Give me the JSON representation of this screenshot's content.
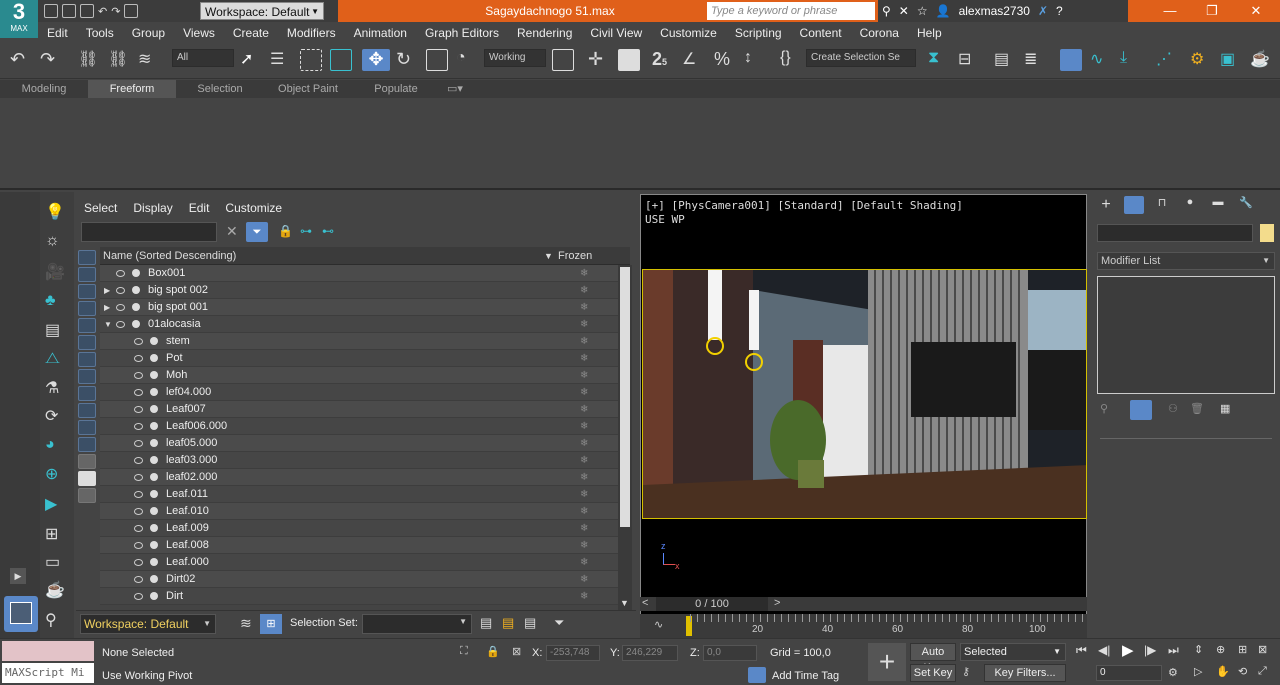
{
  "app": {
    "logo_number": "3",
    "logo_label": "MAX",
    "workspace": "Workspace: Default",
    "filename": "Sagaydachnogo 51.max",
    "search_placeholder": "Type a keyword or phrase",
    "user": "alexmas2730"
  },
  "menu": [
    "Edit",
    "Tools",
    "Group",
    "Views",
    "Create",
    "Modifiers",
    "Animation",
    "Graph Editors",
    "Rendering",
    "Civil View",
    "Customize",
    "Scripting",
    "Content",
    "Corona",
    "Help"
  ],
  "toolbar": {
    "filter_all": "All",
    "coord_system": "Working",
    "snap_label": "2",
    "snap_sub": "5",
    "percent_snap": "%",
    "selection_set": "Create Selection Se"
  },
  "ribbon_tabs": [
    "Modeling",
    "Freeform",
    "Selection",
    "Object Paint",
    "Populate"
  ],
  "explorer": {
    "menu": [
      "Select",
      "Display",
      "Edit",
      "Customize"
    ],
    "col_name": "Name (Sorted Descending)",
    "col_frozen": "Frozen",
    "frozen_glyph": "❄",
    "rows": [
      {
        "name": "Box001",
        "level": 0,
        "expand": ""
      },
      {
        "name": "big spot 002",
        "level": 0,
        "expand": "▶"
      },
      {
        "name": "big spot 001",
        "level": 0,
        "expand": "▶"
      },
      {
        "name": "01alocasia",
        "level": 0,
        "expand": "▼"
      },
      {
        "name": "stem",
        "level": 1,
        "expand": ""
      },
      {
        "name": "Pot",
        "level": 1,
        "expand": ""
      },
      {
        "name": "Moh",
        "level": 1,
        "expand": ""
      },
      {
        "name": "lef04.000",
        "level": 1,
        "expand": ""
      },
      {
        "name": "Leaf007",
        "level": 1,
        "expand": ""
      },
      {
        "name": "Leaf006.000",
        "level": 1,
        "expand": ""
      },
      {
        "name": "leaf05.000",
        "level": 1,
        "expand": ""
      },
      {
        "name": "leaf03.000",
        "level": 1,
        "expand": ""
      },
      {
        "name": "leaf02.000",
        "level": 1,
        "expand": ""
      },
      {
        "name": "Leaf.011",
        "level": 1,
        "expand": ""
      },
      {
        "name": "Leaf.010",
        "level": 1,
        "expand": ""
      },
      {
        "name": "Leaf.009",
        "level": 1,
        "expand": ""
      },
      {
        "name": "Leaf.008",
        "level": 1,
        "expand": ""
      },
      {
        "name": "Leaf.000",
        "level": 1,
        "expand": ""
      },
      {
        "name": "Dirt02",
        "level": 1,
        "expand": ""
      },
      {
        "name": "Dirt",
        "level": 1,
        "expand": ""
      }
    ],
    "workspace": "Workspace: Default",
    "selection_set_label": "Selection Set:"
  },
  "viewport": {
    "label": "[+] [PhysCamera001] [Standard] [Default Shading]",
    "label2": "USE WP",
    "time_counter": "0 / 100",
    "ticks": [
      "20",
      "40",
      "60",
      "80",
      "100"
    ],
    "axis_z": "z",
    "axis_x": "x"
  },
  "command_panel": {
    "modifier_list": "Modifier List"
  },
  "status": {
    "selection": "None Selected",
    "pivot": "Use Working Pivot",
    "maxscript": "MAXScript Mi",
    "x_label": "X:",
    "x_value": "-253,748",
    "y_label": "Y:",
    "y_value": "246,229",
    "z_label": "Z:",
    "z_value": "0,0",
    "grid": "Grid = 100,0",
    "add_time_tag": "Add Time Tag",
    "auto_key": "Auto Key",
    "set_key": "Set Key",
    "selected": "Selected",
    "key_filters": "Key Filters...",
    "frame": "0"
  },
  "colors": {
    "title_orange": "#e0601a",
    "accent_blue": "#5a88c8",
    "icon_teal": "#39c1d0",
    "selection_yellow": "#d4c000"
  }
}
